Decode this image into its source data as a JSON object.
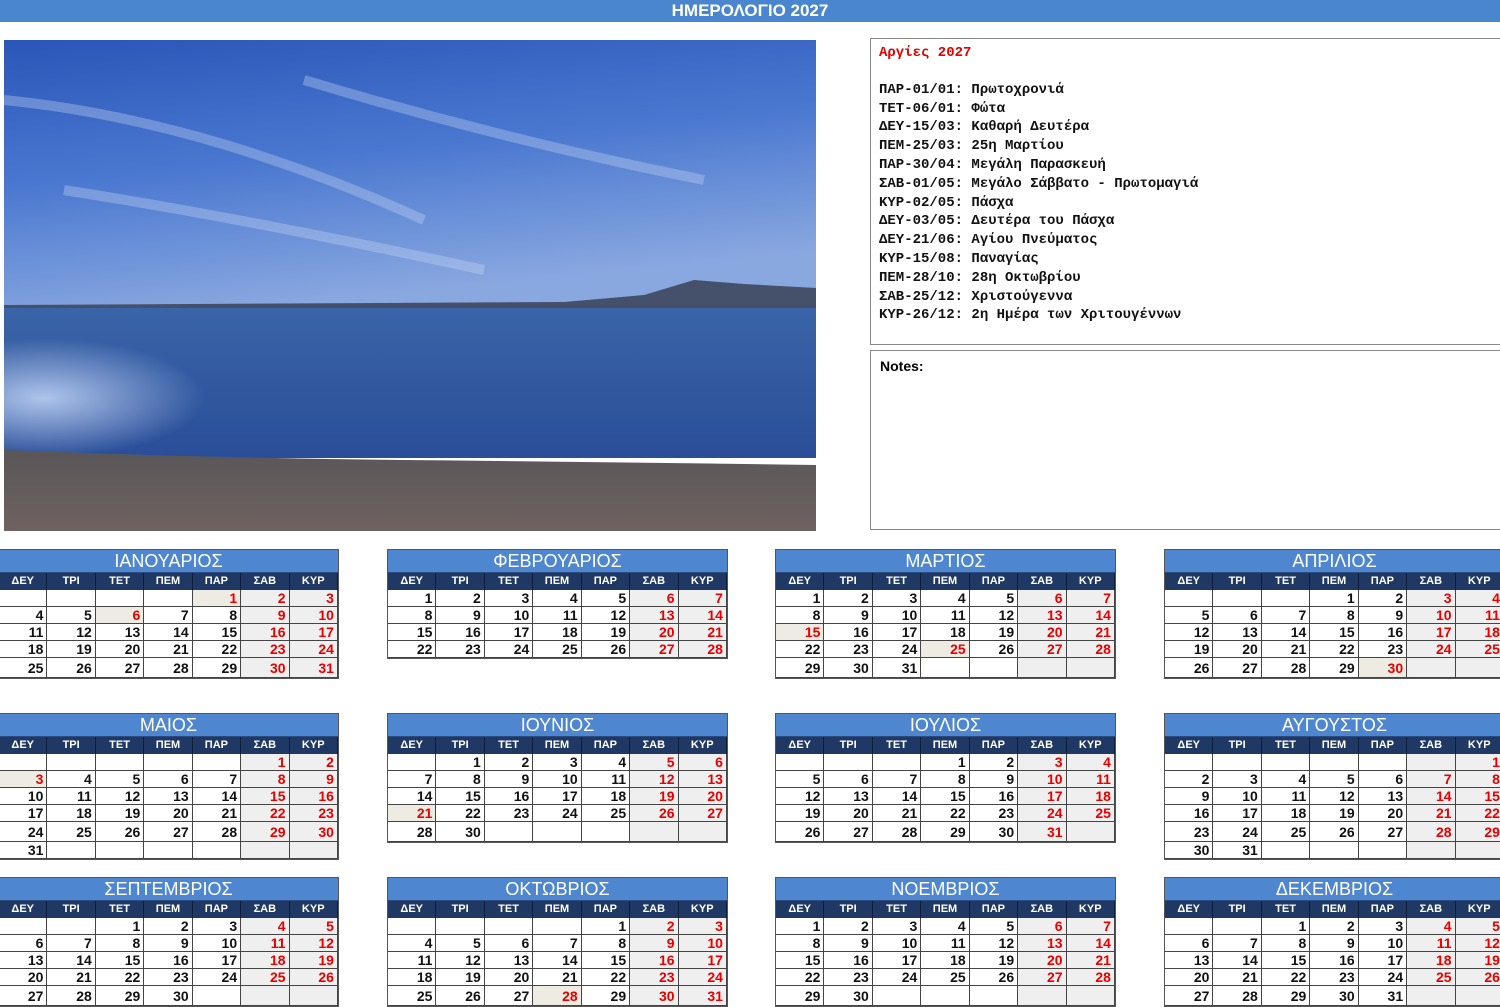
{
  "title": "ΗΜΕΡΟΛΟΓΙΟ 2027",
  "holidays": {
    "title": "Αργίες 2027",
    "items": [
      "ΠΑΡ-01/01: Πρωτοχρονιά",
      "ΤΕΤ-06/01: Φώτα",
      "ΔΕΥ-15/03: Καθαρή Δευτέρα",
      "ΠΕΜ-25/03: 25η Μαρτίου",
      "ΠΑΡ-30/04: Μεγάλη Παρασκευή",
      "ΣΑΒ-01/05: Μεγάλο Σάββατο - Πρωτομαγιά",
      "ΚΥΡ-02/05: Πάσχα",
      "ΔΕΥ-03/05: Δευτέρα του Πάσχα",
      "ΔΕΥ-21/06: Αγίου Πνεύματος",
      "ΚΥΡ-15/08: Παναγίας",
      "ΠΕΜ-28/10: 28η Οκτωβρίου",
      "ΣΑΒ-25/12: Χριστούγεννα",
      "ΚΥΡ-26/12: 2η Ημέρα των Χριτουγέννων"
    ]
  },
  "notes_label": "Notes:",
  "weekdays": [
    "ΔΕΥ",
    "ΤΡΙ",
    "ΤΕΤ",
    "ΠΕΜ",
    "ΠΑΡ",
    "ΣΑΒ",
    "ΚΥΡ"
  ],
  "colors": {
    "accent": "#4f86d0",
    "header": "#1f3864",
    "holiday_text": "#e60000",
    "weekend_bg": "#efefef",
    "holiday_bg": "#eeebe2"
  },
  "months": [
    {
      "name": "ΙΑΝΟΥΑΡΙΟΣ",
      "holidays": [
        1,
        6
      ],
      "weeks": [
        [
          null,
          null,
          null,
          null,
          1,
          2,
          3
        ],
        [
          4,
          5,
          6,
          7,
          8,
          9,
          10
        ],
        [
          11,
          12,
          13,
          14,
          15,
          16,
          17
        ],
        [
          18,
          19,
          20,
          21,
          22,
          23,
          24
        ],
        [
          25,
          26,
          27,
          28,
          29,
          30,
          31
        ]
      ]
    },
    {
      "name": "ΦΕΒΡΟΥΑΡΙΟΣ",
      "holidays": [],
      "weeks": [
        [
          1,
          2,
          3,
          4,
          5,
          6,
          7
        ],
        [
          8,
          9,
          10,
          11,
          12,
          13,
          14
        ],
        [
          15,
          16,
          17,
          18,
          19,
          20,
          21
        ],
        [
          22,
          23,
          24,
          25,
          26,
          27,
          28
        ]
      ]
    },
    {
      "name": "ΜΑΡΤΙΟΣ",
      "holidays": [
        15,
        25
      ],
      "weeks": [
        [
          1,
          2,
          3,
          4,
          5,
          6,
          7
        ],
        [
          8,
          9,
          10,
          11,
          12,
          13,
          14
        ],
        [
          15,
          16,
          17,
          18,
          19,
          20,
          21
        ],
        [
          22,
          23,
          24,
          25,
          26,
          27,
          28
        ],
        [
          29,
          30,
          31,
          null,
          null,
          null,
          null
        ]
      ]
    },
    {
      "name": "ΑΠΡΙΛΙΟΣ",
      "holidays": [
        30
      ],
      "weeks": [
        [
          null,
          null,
          null,
          1,
          2,
          3,
          4
        ],
        [
          5,
          6,
          7,
          8,
          9,
          10,
          11
        ],
        [
          12,
          13,
          14,
          15,
          16,
          17,
          18
        ],
        [
          19,
          20,
          21,
          22,
          23,
          24,
          25
        ],
        [
          26,
          27,
          28,
          29,
          30,
          null,
          null
        ]
      ]
    },
    {
      "name": "ΜΑΙΟΣ",
      "holidays": [
        1,
        2,
        3
      ],
      "weeks": [
        [
          null,
          null,
          null,
          null,
          null,
          1,
          2
        ],
        [
          3,
          4,
          5,
          6,
          7,
          8,
          9
        ],
        [
          10,
          11,
          12,
          13,
          14,
          15,
          16
        ],
        [
          17,
          18,
          19,
          20,
          21,
          22,
          23
        ],
        [
          24,
          25,
          26,
          27,
          28,
          29,
          30
        ],
        [
          31,
          null,
          null,
          null,
          null,
          null,
          null
        ]
      ]
    },
    {
      "name": "ΙΟΥΝΙΟΣ",
      "holidays": [
        21
      ],
      "weeks": [
        [
          null,
          1,
          2,
          3,
          4,
          5,
          6
        ],
        [
          7,
          8,
          9,
          10,
          11,
          12,
          13
        ],
        [
          14,
          15,
          16,
          17,
          18,
          19,
          20
        ],
        [
          21,
          22,
          23,
          24,
          25,
          26,
          27
        ],
        [
          28,
          30,
          null,
          null,
          null,
          null,
          null
        ]
      ]
    },
    {
      "name": "ΙΟΥΛΙΟΣ",
      "holidays": [],
      "weeks": [
        [
          null,
          null,
          null,
          1,
          2,
          3,
          4
        ],
        [
          5,
          6,
          7,
          8,
          9,
          10,
          11
        ],
        [
          12,
          13,
          14,
          15,
          16,
          17,
          18
        ],
        [
          19,
          20,
          21,
          22,
          23,
          24,
          25
        ],
        [
          26,
          27,
          28,
          29,
          30,
          31,
          null
        ]
      ]
    },
    {
      "name": "ΑΥΓΟΥΣΤΟΣ",
      "holidays": [
        15
      ],
      "weeks": [
        [
          null,
          null,
          null,
          null,
          null,
          null,
          1
        ],
        [
          2,
          3,
          4,
          5,
          6,
          7,
          8
        ],
        [
          9,
          10,
          11,
          12,
          13,
          14,
          15
        ],
        [
          16,
          17,
          18,
          19,
          20,
          21,
          22
        ],
        [
          23,
          24,
          25,
          26,
          27,
          28,
          29
        ],
        [
          30,
          31,
          null,
          null,
          null,
          null,
          null
        ]
      ]
    },
    {
      "name": "ΣΕΠΤΕΜΒΡΙΟΣ",
      "holidays": [],
      "weeks": [
        [
          null,
          null,
          1,
          2,
          3,
          4,
          5
        ],
        [
          6,
          7,
          8,
          9,
          10,
          11,
          12
        ],
        [
          13,
          14,
          15,
          16,
          17,
          18,
          19
        ],
        [
          20,
          21,
          22,
          23,
          24,
          25,
          26
        ],
        [
          27,
          28,
          29,
          30,
          null,
          null,
          null
        ]
      ]
    },
    {
      "name": "ΟΚΤΩΒΡΙΟΣ",
      "holidays": [
        28
      ],
      "weeks": [
        [
          null,
          null,
          null,
          null,
          1,
          2,
          3
        ],
        [
          4,
          5,
          6,
          7,
          8,
          9,
          10
        ],
        [
          11,
          12,
          13,
          14,
          15,
          16,
          17
        ],
        [
          18,
          19,
          20,
          21,
          22,
          23,
          24
        ],
        [
          25,
          26,
          27,
          28,
          29,
          30,
          31
        ]
      ]
    },
    {
      "name": "ΝΟΕΜΒΡΙΟΣ",
      "holidays": [],
      "weeks": [
        [
          1,
          2,
          3,
          4,
          5,
          6,
          7
        ],
        [
          8,
          9,
          10,
          11,
          12,
          13,
          14
        ],
        [
          15,
          16,
          17,
          18,
          19,
          20,
          21
        ],
        [
          22,
          23,
          24,
          25,
          26,
          27,
          28
        ],
        [
          29,
          30,
          null,
          null,
          null,
          null,
          null
        ]
      ]
    },
    {
      "name": "ΔΕΚΕΜΒΡΙΟΣ",
      "holidays": [
        25,
        26
      ],
      "weeks": [
        [
          null,
          null,
          1,
          2,
          3,
          4,
          5
        ],
        [
          6,
          7,
          8,
          9,
          10,
          11,
          12
        ],
        [
          13,
          14,
          15,
          16,
          17,
          18,
          19
        ],
        [
          20,
          21,
          22,
          23,
          24,
          25,
          26
        ],
        [
          27,
          28,
          29,
          30,
          31,
          null,
          null
        ]
      ]
    }
  ]
}
